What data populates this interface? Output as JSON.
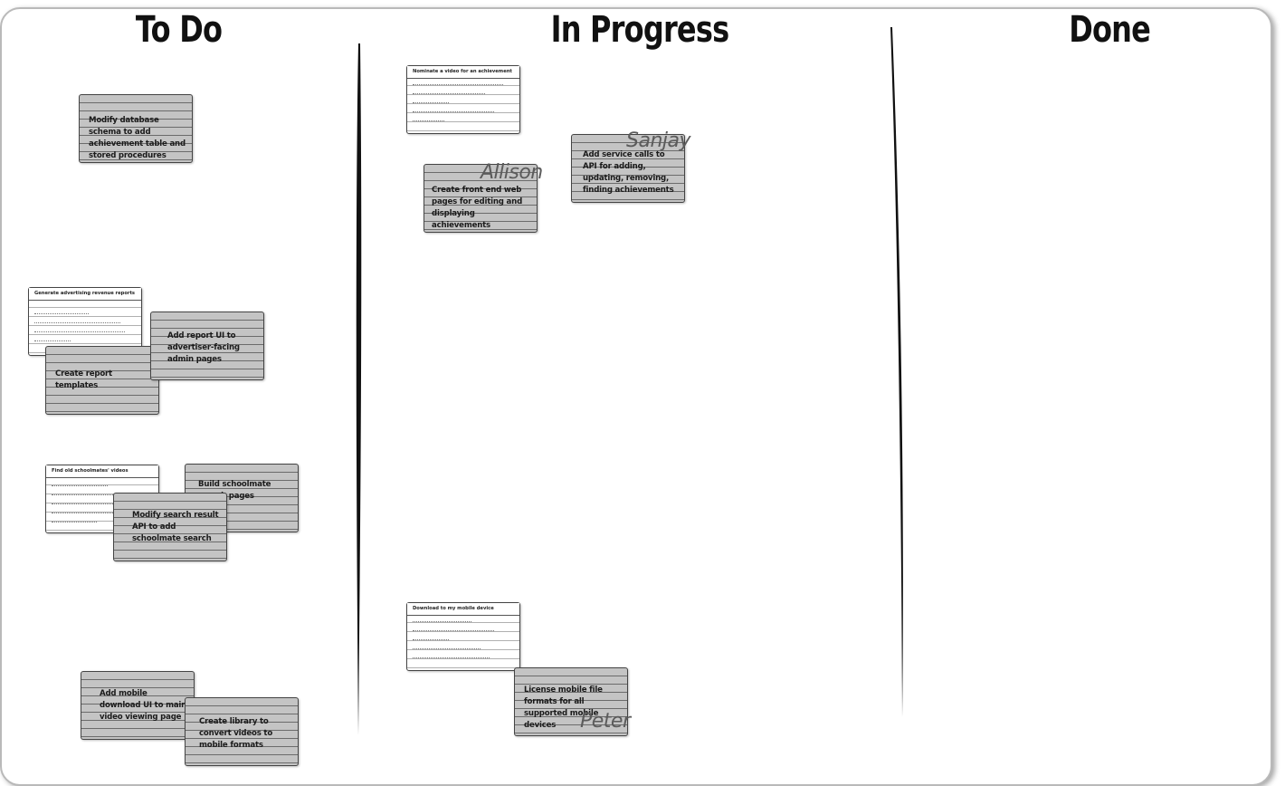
{
  "columns": {
    "todo": "To Do",
    "in_progress": "In Progress",
    "done": "Done"
  },
  "stories": {
    "achievement_video": "Nominate a video for an achievement",
    "ad_reports": "Generate advertising revenue reports",
    "schoolmates": "Find old schoolmates' videos",
    "mobile_download": "Download to my mobile device"
  },
  "tasks": {
    "db_schema": "Modify database schema to add achievement table and stored procedures",
    "report_ui": "Add report UI to advertiser-facing admin pages",
    "report_templates": "Create report templates",
    "schoolmate_pages": "Build schoolmate search pages",
    "search_api": "Modify search result API to add schoolmate search",
    "mobile_ui": "Add mobile download UI to main video viewing page",
    "video_library": "Create library to convert videos to mobile formats",
    "front_end": "Create front end web pages for editing and displaying achievements",
    "service_calls": "Add service calls to API for adding, updating, removing, finding achievements",
    "license_formats": "License mobile file formats for all supported mobile devices"
  },
  "assignees": {
    "allison": "Allison",
    "sanjay": "Sanjay",
    "peter": "Peter"
  }
}
